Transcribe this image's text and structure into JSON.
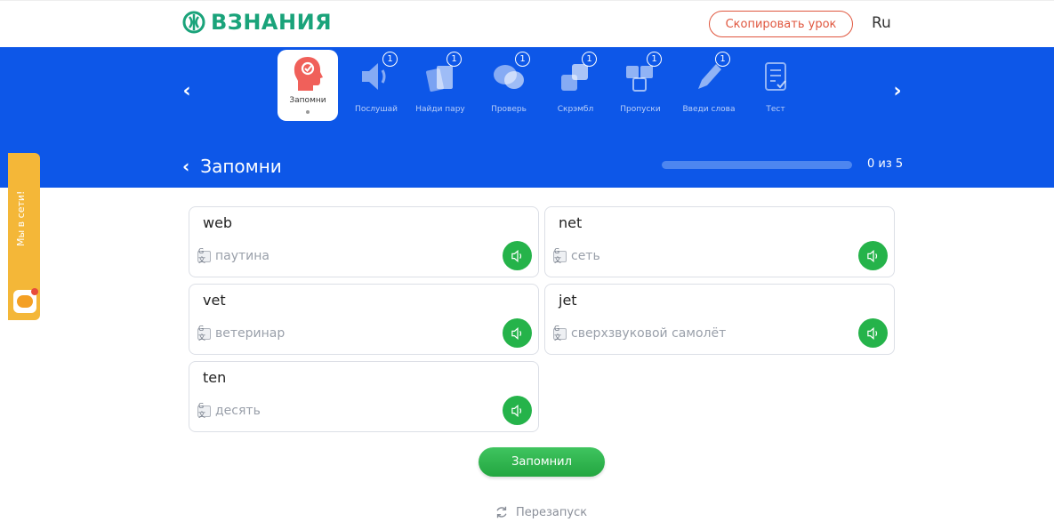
{
  "header": {
    "logo_text": "ВЗНАНИЯ",
    "copy_button": "Скопировать урок",
    "language": "Ru"
  },
  "nav": {
    "prev_arrow": "‹",
    "next_arrow": "›",
    "modes": [
      {
        "label": "Запомни",
        "badge": "",
        "active": true,
        "icon": "head-icon"
      },
      {
        "label": "Послушай",
        "badge": "1",
        "icon": "speaker-icon"
      },
      {
        "label": "Найди пару",
        "badge": "1",
        "icon": "cards-icon"
      },
      {
        "label": "Проверь",
        "badge": "1",
        "icon": "chat-bubbles-icon"
      },
      {
        "label": "Скрэмбл",
        "badge": "1",
        "icon": "squares-icon"
      },
      {
        "label": "Пропуски",
        "badge": "1",
        "icon": "blanks-icon"
      },
      {
        "label": "Введи слова",
        "badge": "1",
        "icon": "pen-icon"
      },
      {
        "label": "Тест",
        "badge": "",
        "icon": "test-icon"
      }
    ]
  },
  "section": {
    "back_arrow": "‹",
    "title": "Запомни",
    "progress_fraction": 0.0,
    "progress_text": "0 из 5"
  },
  "side_tab": {
    "label": "Мы в сети!"
  },
  "cards": [
    {
      "word": "web",
      "translation": "паутина"
    },
    {
      "word": "net",
      "translation": "сеть"
    },
    {
      "word": "vet",
      "translation": "ветеринар"
    },
    {
      "word": "jet",
      "translation": "сверхзвуковой самолёт"
    },
    {
      "word": "ten",
      "translation": "десять"
    }
  ],
  "translate_icon_text": "G文",
  "actions": {
    "remember_button": "Запомнил",
    "restart_label": "Перезапуск"
  },
  "colors": {
    "brand_green": "#1aa37a",
    "band_blue": "#0d57e8",
    "accent_red": "#e0573f",
    "sound_green": "#25b34a",
    "side_tab_orange": "#f4b738"
  }
}
